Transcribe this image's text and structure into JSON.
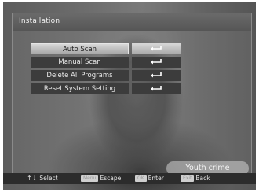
{
  "window": {
    "title": "Installation"
  },
  "menu": {
    "items": [
      {
        "label": "Auto Scan",
        "selected": true
      },
      {
        "label": "Manual Scan",
        "selected": false
      },
      {
        "label": "Delete All Programs",
        "selected": false
      },
      {
        "label": "Reset System Setting",
        "selected": false
      }
    ],
    "enter_icon": "return-arrow-icon"
  },
  "background": {
    "caption": "Youth crime"
  },
  "footer": {
    "select_arrows": "↑↓",
    "select_label": "Select",
    "menu_key": "Menu",
    "escape_label": "Escape",
    "ok_key": "OK",
    "enter_label": "Enter",
    "exit_key": "Exit",
    "back_label": "Back"
  },
  "colors": {
    "selected_bg": "#c0c0c0",
    "item_bg": "#3c3c3c",
    "footer_bg": "#2c2c2c"
  }
}
